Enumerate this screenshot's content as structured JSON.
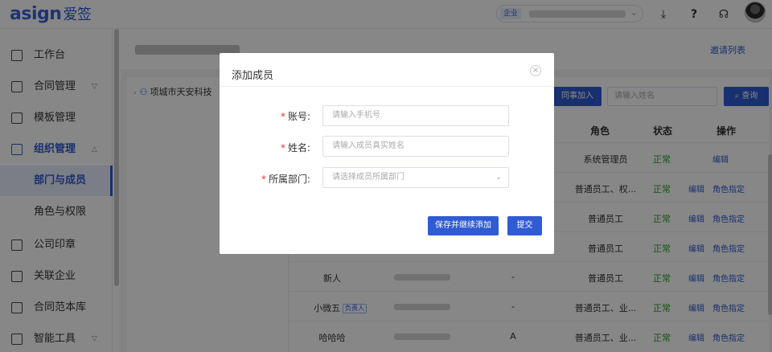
{
  "app": {
    "logo_text": "asign",
    "logo_cn": "爱签"
  },
  "topbar": {
    "company_tag": "企业",
    "icons": [
      "download-icon",
      "help-icon",
      "headset-icon"
    ],
    "icon_glyphs": [
      "⤓",
      "?",
      "☊"
    ]
  },
  "sidebar": {
    "items": [
      {
        "label": "工作台",
        "icon": "desktop-icon"
      },
      {
        "label": "合同管理",
        "icon": "contract-icon"
      },
      {
        "label": "模板管理",
        "icon": "template-icon"
      },
      {
        "label": "组织管理",
        "icon": "org-icon"
      },
      {
        "label": "部门与成员"
      },
      {
        "label": "角色与权限"
      },
      {
        "label": "公司印章",
        "icon": "seal-icon"
      },
      {
        "label": "关联企业",
        "icon": "link-icon"
      },
      {
        "label": "合同范本库",
        "icon": "library-icon"
      },
      {
        "label": "智能工具",
        "icon": "tool-icon"
      }
    ]
  },
  "main": {
    "invite_list": "邀请列表",
    "tree_root": "项城市天安科技",
    "join_button": "同事加入",
    "search_placeholder": "请输入姓名",
    "query_button": "查询",
    "columns": {
      "role": "角色",
      "status": "状态",
      "ops": "操作"
    },
    "rows": [
      {
        "name": "",
        "dept": "",
        "role": "系统管理员",
        "status": "正常",
        "op1": "编辑",
        "op2": ""
      },
      {
        "name": "",
        "dept": "",
        "role": "普通员工、权...",
        "status": "正常",
        "op1": "编辑",
        "op2": "角色指定"
      },
      {
        "name": "",
        "dept": "",
        "role": "普通员工",
        "status": "正常",
        "op1": "编辑",
        "op2": "角色指定"
      },
      {
        "name": "",
        "dept": "",
        "role": "普通员工",
        "status": "正常",
        "op1": "编辑",
        "op2": "角色指定"
      },
      {
        "name": "新人",
        "dept": "-",
        "role": "普通员工",
        "status": "正常",
        "op1": "编辑",
        "op2": "角色指定"
      },
      {
        "name": "小微五",
        "badge": "负责人",
        "dept": "-",
        "role": "普通员工、业...",
        "status": "正常",
        "op1": "编辑",
        "op2": "角色指定"
      },
      {
        "name": "哈哈哈",
        "dept": "A",
        "role": "普通员工、业...",
        "status": "正常",
        "op1": "编辑",
        "op2": "角色指定"
      }
    ]
  },
  "dialog": {
    "title": "添加成员",
    "close": "×",
    "fields": [
      {
        "label": "账号:",
        "placeholder": "请输入手机号"
      },
      {
        "label": "姓名:",
        "placeholder": "请输入成员真实姓名"
      },
      {
        "label": "所属部门:",
        "placeholder": "请选择成员所属部门"
      }
    ],
    "save_continue": "保存并继续添加",
    "submit": "提交"
  },
  "colors": {
    "primary": "#2f5bd3",
    "success": "#2ca02c",
    "required": "#e33333"
  }
}
